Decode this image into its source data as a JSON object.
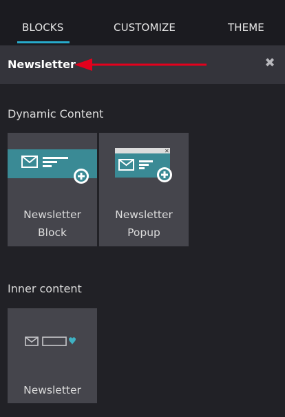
{
  "tabs": [
    {
      "label": "BLOCKS",
      "active": true
    },
    {
      "label": "CUSTOMIZE",
      "active": false
    },
    {
      "label": "THEME",
      "active": false
    }
  ],
  "search": {
    "value": "Newsletter"
  },
  "colors": {
    "accent": "#27aacb",
    "teal": "#3a8a95",
    "arrow": "#e4001c",
    "background": "#212126",
    "card": "#45454c"
  },
  "sections": [
    {
      "title": "Dynamic Content",
      "items": [
        {
          "line1": "Newsletter",
          "line2": "Block",
          "icon": "newsletter-block-icon"
        },
        {
          "line1": "Newsletter",
          "line2": "Popup",
          "icon": "newsletter-popup-icon"
        }
      ]
    },
    {
      "title": "Inner content",
      "items": [
        {
          "line1": "Newsletter",
          "icon": "newsletter-inner-icon"
        }
      ]
    }
  ]
}
